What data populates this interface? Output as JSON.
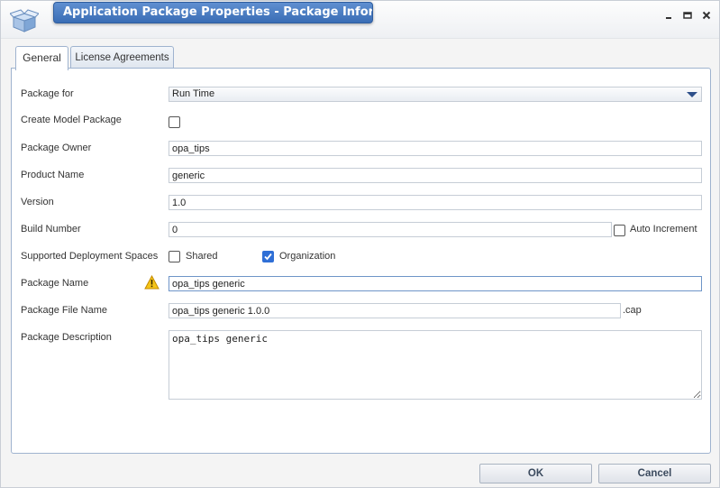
{
  "window": {
    "title": "Application Package Properties - Package Information*",
    "controls": {
      "minimize": "minimize",
      "maximize": "maximize",
      "close": "close"
    }
  },
  "tabs": [
    {
      "label": "General",
      "active": true
    },
    {
      "label": "License Agreements",
      "active": false
    }
  ],
  "form": {
    "package_for": {
      "label": "Package for",
      "value": "Run Time"
    },
    "create_model_package": {
      "label": "Create Model Package",
      "checked": false
    },
    "package_owner": {
      "label": "Package Owner",
      "value": "opa_tips"
    },
    "product_name": {
      "label": "Product Name",
      "value": "generic"
    },
    "version": {
      "label": "Version",
      "value": "1.0"
    },
    "build_number": {
      "label": "Build Number",
      "value": "0",
      "auto_increment_label": "Auto Increment",
      "auto_increment_checked": false
    },
    "deployment_spaces": {
      "label": "Supported Deployment Spaces",
      "options": [
        {
          "label": "Shared",
          "checked": false
        },
        {
          "label": "Organization",
          "checked": true
        }
      ]
    },
    "package_name": {
      "label": "Package Name",
      "value": "opa_tips generic",
      "warning_icon": "warning-icon"
    },
    "package_file_name": {
      "label": "Package File Name",
      "value": "opa_tips generic 1.0.0",
      "extension": ".cap"
    },
    "package_description": {
      "label": "Package Description",
      "value": "opa_tips generic"
    }
  },
  "buttons": {
    "ok": "OK",
    "cancel": "Cancel"
  },
  "colors": {
    "title_bar": "#3a6db5",
    "accent_checkbox": "#2f6fd6",
    "warning": "#f0b400"
  }
}
